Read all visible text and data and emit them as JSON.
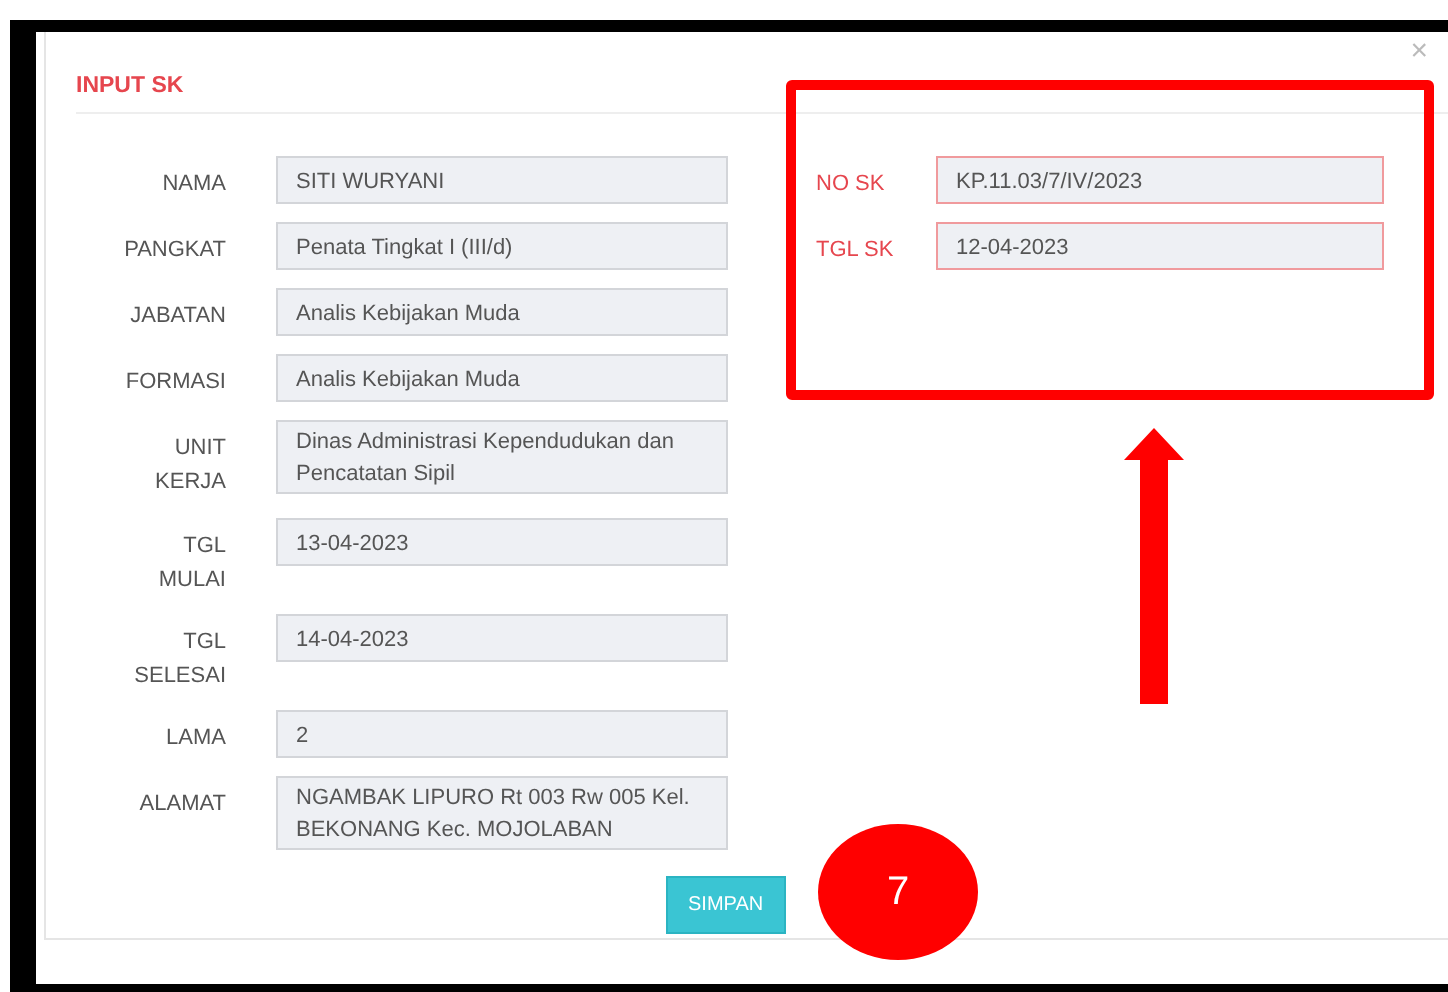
{
  "dialog": {
    "title": "INPUT SK",
    "close": "×"
  },
  "fields_left": [
    {
      "label": "NAMA",
      "value": "SITI WURYANI",
      "kind": "input"
    },
    {
      "label": "PANGKAT",
      "value": "Penata Tingkat I (III/d)",
      "kind": "input"
    },
    {
      "label": "JABATAN",
      "value": "Analis Kebijakan Muda",
      "kind": "input"
    },
    {
      "label": "FORMASI",
      "value": "Analis Kebijakan Muda",
      "kind": "input"
    },
    {
      "label": "UNIT KERJA",
      "value": "Dinas Administrasi Kependudukan dan Pencatatan Sipil",
      "kind": "textarea"
    },
    {
      "label": "TGL MULAI",
      "value": "13-04-2023",
      "kind": "input"
    },
    {
      "label": "TGL SELESAI",
      "value": "14-04-2023",
      "kind": "input"
    },
    {
      "label": "LAMA",
      "value": "2",
      "kind": "input"
    },
    {
      "label": "ALAMAT",
      "value": "NGAMBAK LIPURO Rt 003 Rw 005 Kel. BEKONANG Kec. MOJOLABAN",
      "kind": "scrollarea"
    }
  ],
  "fields_right": [
    {
      "label": "NO SK",
      "value": "KP.11.03/7/IV/2023",
      "error": true
    },
    {
      "label": "TGL SK",
      "value": "12-04-2023",
      "error": true
    }
  ],
  "button": "SIMPAN",
  "annotations": [
    {
      "kind": "box"
    },
    {
      "kind": "arrow"
    },
    {
      "kind": "badge",
      "text": "7"
    }
  ]
}
